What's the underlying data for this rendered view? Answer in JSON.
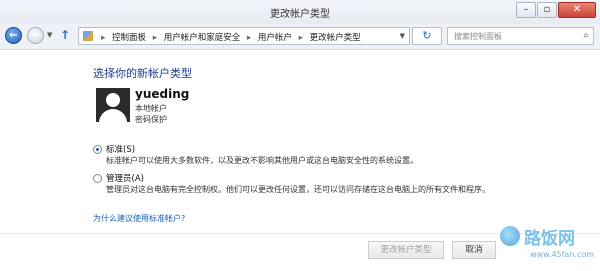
{
  "window": {
    "title": "更改帐户类型",
    "controls": {
      "min_icon": "minimize-icon",
      "max_icon": "maximize-icon",
      "close_icon": "close-icon"
    }
  },
  "nav": {
    "address": {
      "crumbs": [
        "控制面板",
        "用户帐户和家庭安全",
        "用户帐户",
        "更改帐户类型"
      ],
      "separator": "▸"
    },
    "search": {
      "placeholder": "搜索控制面板"
    }
  },
  "main": {
    "title": "选择你的新帐户类型",
    "user": {
      "name": "yueding",
      "info": [
        "本地帐户",
        "密码保护"
      ]
    },
    "options": [
      {
        "label": "标准(S)",
        "checked": true,
        "description": "标准帐户可以使用大多数软件，以及更改不影响其他用户或这台电脑安全性的系统设置。"
      },
      {
        "label": "管理员(A)",
        "checked": false,
        "description": "管理员对这台电脑有完全控制权。他们可以更改任何设置，还可以访问存储在这台电脑上的所有文件和程序。"
      }
    ],
    "help_link": "为什么建议使用标准帐户?"
  },
  "footer": {
    "change_button": "更改帐户类型",
    "cancel_button": "取消"
  },
  "watermark": {
    "brand": "路饭网",
    "url": "www.45fan.com"
  },
  "colors": {
    "link": "#1b5fb8",
    "title": "#1e3a8c",
    "close": "#c84536"
  }
}
